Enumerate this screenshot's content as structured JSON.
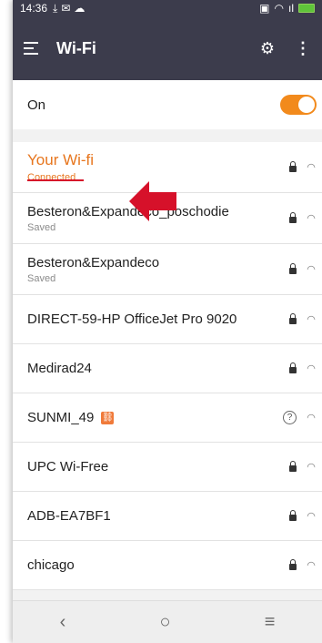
{
  "status": {
    "time": "14:36"
  },
  "app": {
    "title": "Wi-Fi"
  },
  "toggle_row": {
    "label": "On",
    "state": "on",
    "accent": "#f28a1c"
  },
  "networks": [
    {
      "name": "Your Wi-fi",
      "status": "Connected",
      "security": "lock-icon"
    },
    {
      "name": "Besteron&Expandeco_poschodie",
      "status": "Saved",
      "security": "lock-icon"
    },
    {
      "name": "Besteron&Expandeco",
      "status": "Saved",
      "security": "lock-icon"
    },
    {
      "name": "DIRECT-59-HP OfficeJet Pro 9020",
      "status": "",
      "security": "lock-icon"
    },
    {
      "name": "Medirad24",
      "status": "",
      "security": "lock-icon"
    },
    {
      "name": "SUNMI_49",
      "status": "",
      "security": "help-icon",
      "badge": "link-icon"
    },
    {
      "name": "UPC Wi-Free",
      "status": "",
      "security": "lock-icon"
    },
    {
      "name": "ADB-EA7BF1",
      "status": "",
      "security": "lock-icon"
    },
    {
      "name": "chicago",
      "status": "",
      "security": "lock-icon"
    }
  ],
  "annotation": {
    "arrow_color": "#d6112a"
  },
  "navbar": {
    "back": "‹",
    "home": "○",
    "recents": "≡"
  }
}
